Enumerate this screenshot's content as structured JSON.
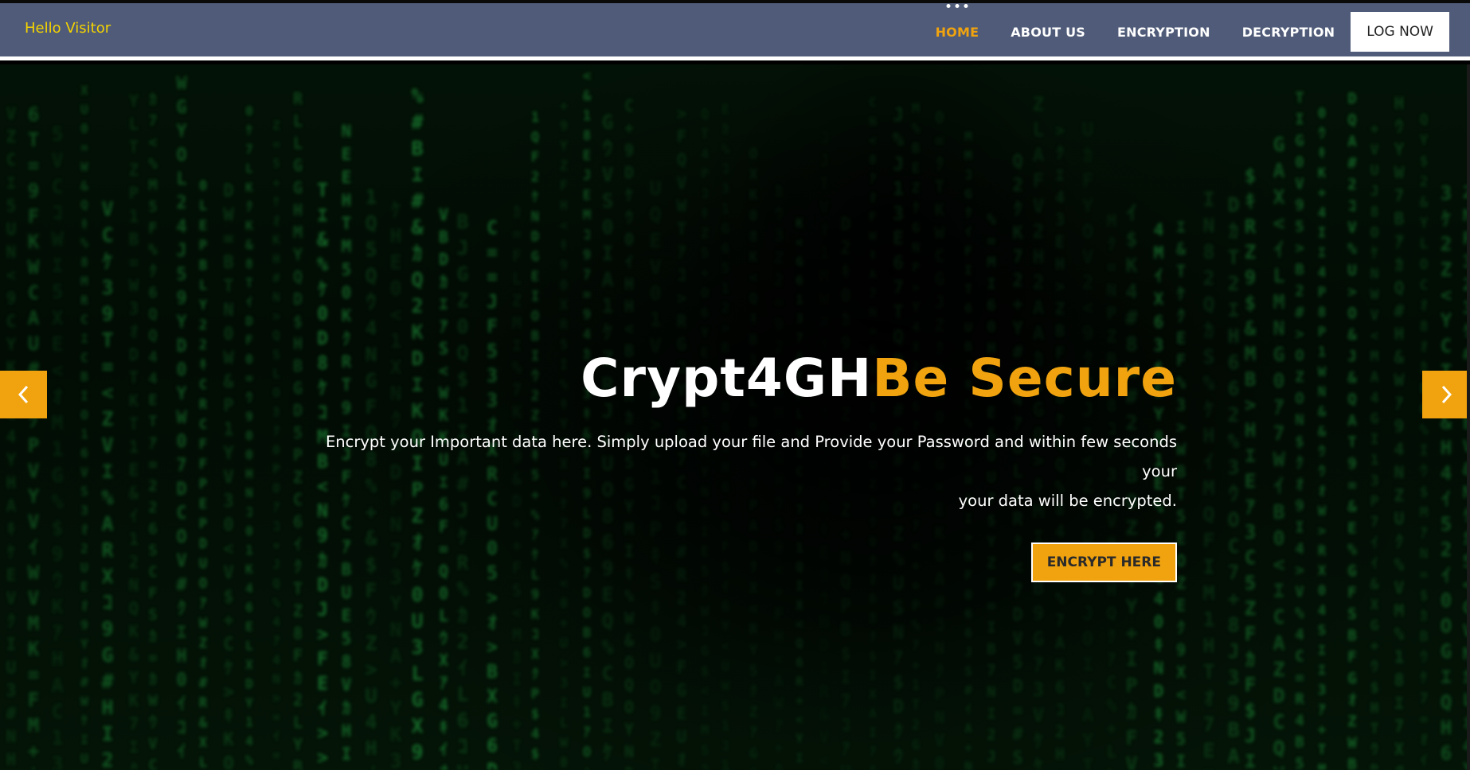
{
  "nav": {
    "greeting": "Hello Visitor",
    "links": [
      {
        "label": "HOME",
        "active": true
      },
      {
        "label": "ABOUT US",
        "active": false
      },
      {
        "label": "ENCRYPTION",
        "active": false
      },
      {
        "label": "DECRYPTION",
        "active": false
      }
    ],
    "login_label": "LOG NOW"
  },
  "hero": {
    "title_main": "Crypt4GH",
    "title_accent": "Be Secure",
    "subtitle_line1": "Encrypt your Important data here. Simply upload your file and Provide your Password and within few seconds your",
    "subtitle_line2": "your data will be encrypted.",
    "cta_label": "ENCRYPT HERE"
  },
  "carousel": {
    "prev_icon": "chevron-left-icon",
    "next_icon": "chevron-right-icon"
  },
  "colors": {
    "accent": "#f0a30f",
    "navbar_bg": "#4f5b78",
    "greeting": "#f5d300",
    "matrix_green": "#1f9a3c"
  }
}
